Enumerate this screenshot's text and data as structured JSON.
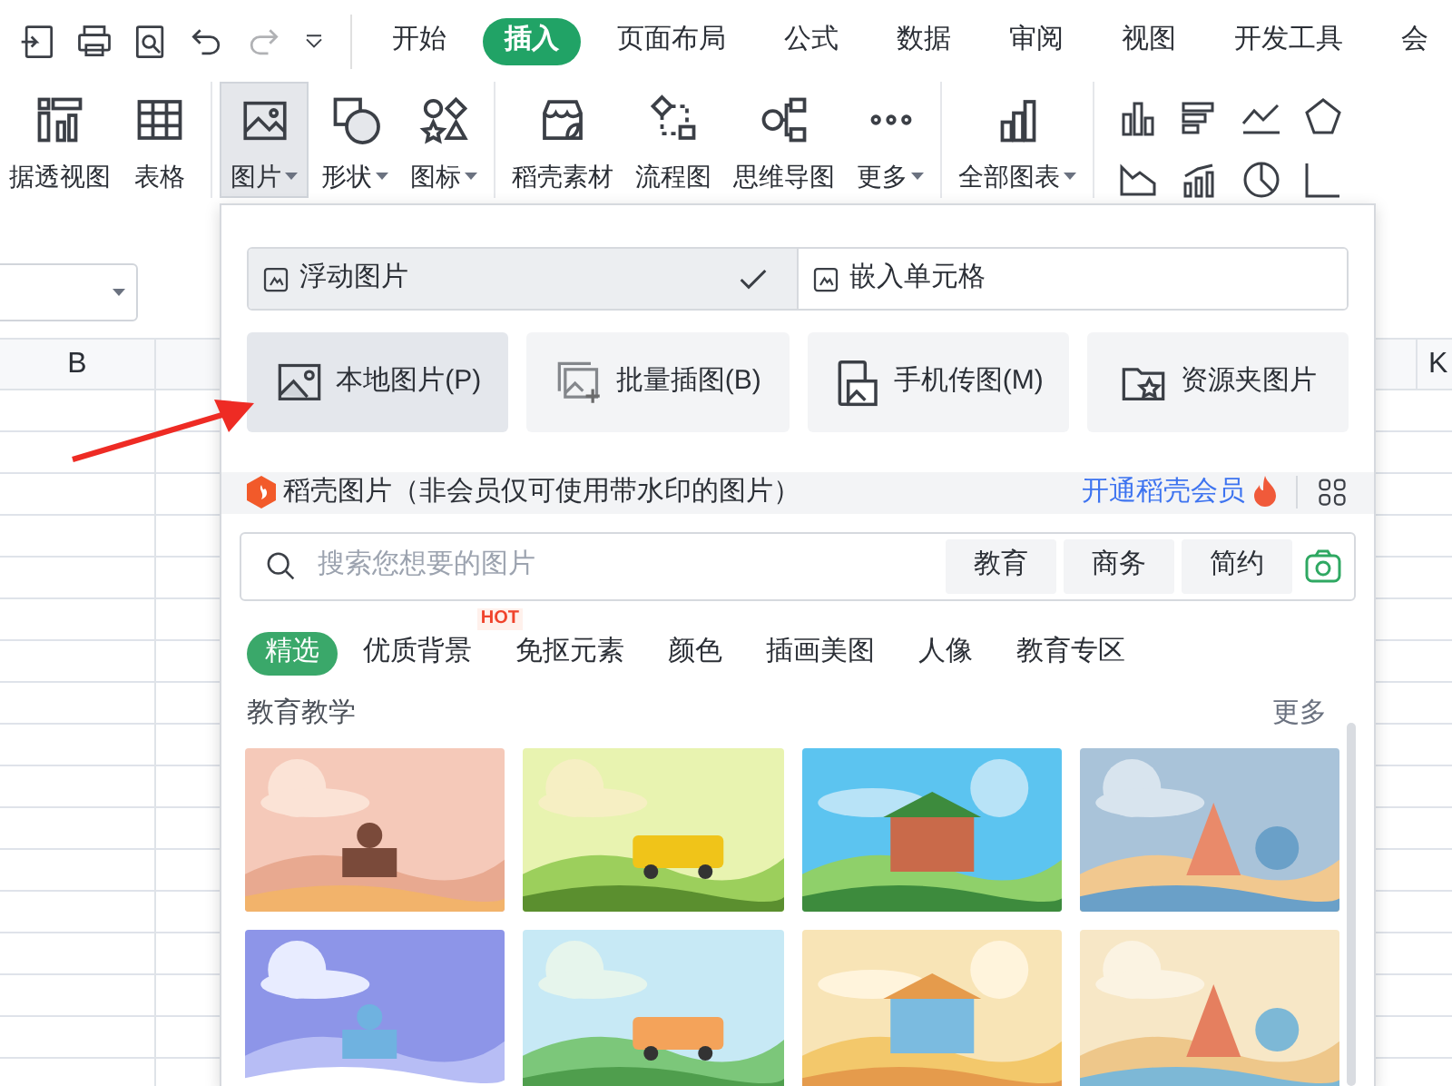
{
  "ribbon_tabs": [
    {
      "label": "开始",
      "selected": false
    },
    {
      "label": "插入",
      "selected": true
    },
    {
      "label": "页面布局",
      "selected": false
    },
    {
      "label": "公式",
      "selected": false
    },
    {
      "label": "数据",
      "selected": false
    },
    {
      "label": "审阅",
      "selected": false
    },
    {
      "label": "视图",
      "selected": false
    },
    {
      "label": "开发工具",
      "selected": false
    },
    {
      "label": "会",
      "selected": false
    }
  ],
  "toolbar_groups": [
    [
      {
        "kind": "pivot",
        "label": "据透视图",
        "dropdown": false,
        "selected": false
      },
      {
        "kind": "table",
        "label": "表格",
        "dropdown": false,
        "selected": false
      }
    ],
    [
      {
        "kind": "picture",
        "label": "图片",
        "dropdown": true,
        "selected": true
      },
      {
        "kind": "shape",
        "label": "形状",
        "dropdown": true,
        "selected": false
      },
      {
        "kind": "icons",
        "label": "图标",
        "dropdown": true,
        "selected": false
      }
    ],
    [
      {
        "kind": "store",
        "label": "稻壳素材",
        "dropdown": false,
        "selected": false
      },
      {
        "kind": "flow",
        "label": "流程图",
        "dropdown": false,
        "selected": false
      },
      {
        "kind": "mind",
        "label": "思维导图",
        "dropdown": false,
        "selected": false
      },
      {
        "kind": "more",
        "label": "更多",
        "dropdown": true,
        "selected": false
      }
    ],
    [
      {
        "kind": "chart",
        "label": "全部图表",
        "dropdown": true,
        "selected": false
      }
    ]
  ],
  "sheet": {
    "columns": [
      "B",
      "K"
    ]
  },
  "picture_menu": {
    "modes": [
      {
        "label": "浮动图片",
        "selected": true
      },
      {
        "label": "嵌入单元格",
        "selected": false
      }
    ],
    "sources": [
      {
        "kind": "local",
        "label": "本地图片(P)",
        "selected": true
      },
      {
        "kind": "batch",
        "label": "批量插图(B)",
        "selected": false
      },
      {
        "kind": "phone",
        "label": "手机传图(M)",
        "selected": false
      },
      {
        "kind": "folder",
        "label": "资源夹图片",
        "selected": false
      }
    ],
    "library": {
      "title": "稻壳图片（非会员仅可使用带水印的图片）",
      "member_link": "开通稻壳会员"
    },
    "search": {
      "placeholder": "搜索您想要的图片",
      "tags": [
        "教育",
        "商务",
        "简约"
      ]
    },
    "categories": [
      {
        "label": "精选",
        "selected": true
      },
      {
        "label": "优质背景",
        "selected": false,
        "badge": "HOT"
      },
      {
        "label": "免抠元素",
        "selected": false
      },
      {
        "label": "颜色",
        "selected": false
      },
      {
        "label": "插画美图",
        "selected": false
      },
      {
        "label": "人像",
        "selected": false
      },
      {
        "label": "教育专区",
        "selected": false
      }
    ],
    "section": {
      "title": "教育教学",
      "more": "更多"
    }
  }
}
